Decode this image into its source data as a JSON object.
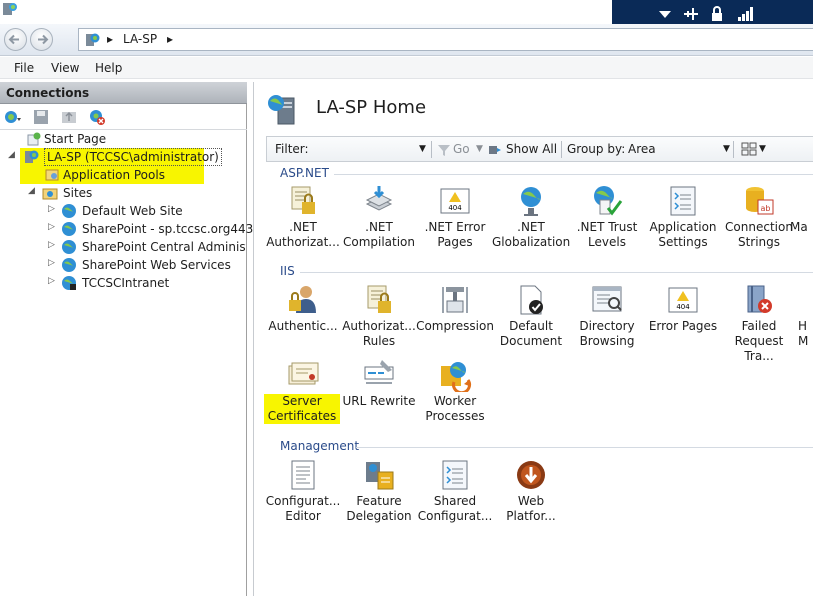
{
  "address": {
    "segments": [
      "LA-SP"
    ],
    "sep": "▸"
  },
  "menu": {
    "file": "File",
    "view": "View",
    "help": "Help"
  },
  "connections": {
    "header": "Connections",
    "tree": {
      "start_page": "Start Page",
      "server": "LA-SP (TCCSC\\administrator)",
      "app_pools": "Application Pools",
      "sites": "Sites",
      "default_web_site": "Default Web Site",
      "sharepoint_sp": "SharePoint - sp.tccsc.org443",
      "sharepoint_central": "SharePoint Central Administrat",
      "sharepoint_web_services": "SharePoint Web Services",
      "tccsc_intranet": "TCCSCIntranet"
    }
  },
  "main": {
    "title": "LA-SP Home",
    "filter": {
      "label": "Filter:",
      "go": "Go",
      "show_all": "Show All",
      "group_by_label": "Group by:",
      "group_by_value": "Area"
    },
    "groups": {
      "aspnet": "ASP.NET",
      "iis": "IIS",
      "management": "Management"
    },
    "features": {
      "net_authorization": ".NET\nAuthorizat...",
      "net_compilation": ".NET\nCompilation",
      "net_error_pages": ".NET Error\nPages",
      "net_globalization": ".NET\nGlobalization",
      "net_trust_levels": ".NET Trust\nLevels",
      "application_settings": "Application\nSettings",
      "connection_strings": "Connection\nStrings",
      "machine_key": "Ma",
      "authentication": "Authentic...",
      "authorization_rules": "Authorizat...\nRules",
      "compression": "Compression",
      "default_document": "Default\nDocument",
      "directory_browsing": "Directory\nBrowsing",
      "error_pages": "Error Pages",
      "failed_request": "Failed\nRequest Tra...",
      "handler_mappings": "H\nM",
      "server_certificates": "Server\nCertificates",
      "url_rewrite": "URL Rewrite",
      "worker_processes": "Worker\nProcesses",
      "configuration_editor": "Configurat...\nEditor",
      "feature_delegation": "Feature\nDelegation",
      "shared_configuration": "Shared\nConfigurat...",
      "web_platform": "Web\nPlatfor..."
    }
  },
  "colors": {
    "highlight": "#f8f500",
    "group_label": "#2a4b8a",
    "taskbar": "#0a2a57"
  }
}
